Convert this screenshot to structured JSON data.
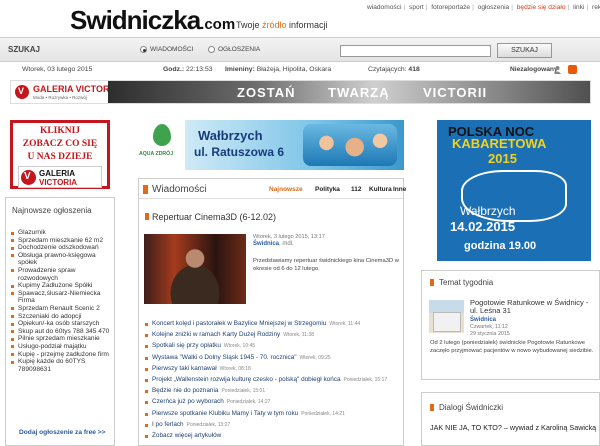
{
  "header": {
    "logo_main": "Swidniczka",
    "logo_domain": ".com",
    "tagline_before": "Twoje ",
    "tagline_highlight": "źródło",
    "tagline_after": " informacji",
    "nav": [
      {
        "label": "wiadomości"
      },
      {
        "label": "sport"
      },
      {
        "label": "fotoreportaże"
      },
      {
        "label": "ogłoszenia"
      },
      {
        "label": "będzie się działo"
      },
      {
        "label": "linki"
      },
      {
        "label": "reklama"
      }
    ]
  },
  "search": {
    "label": "SZUKAJ",
    "option_news": "WIADOMOŚCI",
    "option_ads": "OGŁOSZENIA",
    "value": "",
    "button": "SZUKAJ"
  },
  "infobar": {
    "date": "Wtorek, 03 lutego 2015",
    "time_label": "Godz.:",
    "time": "22:13:53",
    "names_label": "Imieniny:",
    "names": "Błażeja, Hipolita, Oskara",
    "readers_label": "Czytających:",
    "readers": "418",
    "login_status": "Niezalogowany"
  },
  "banner": {
    "logo_line1": "GALERIA VICTORIA",
    "logo_line2": "Moda • Rozrywka • Rozwój",
    "words": [
      "ZOSTAŃ",
      "TWARZĄ",
      "VICTORII"
    ]
  },
  "left_ad": {
    "line1": "KLIKNIJ",
    "line2": "ZOBACZ CO SIĘ",
    "line3": "U NAS DZIEJE",
    "brand1": "GALERIA",
    "brand2": "VICTORIA"
  },
  "classifieds": {
    "title": "Najnowsze ogłoszenia",
    "items": [
      "Glazurnik",
      "Sprzedam mieszkanie 62 m2",
      "Dochodzenie odszkodowań",
      "Obsługa prawno-księgowa spółek",
      "Prowadzenie spraw rozwodowych",
      "Kupimy Zadłużone Spółki",
      "Spawacz,ślusarz-Niemiecka Firma",
      "Sprzedam Renault Scenic 2",
      "Szczeniaki do adopcji",
      "Opiekun/-ka osób starszych",
      "Skup aut do 60tys 788 345 470",
      "Pilnie sprzedam mieszkanie",
      "Usługo-podział majątku",
      "Kupię - przejmę zadłużone firm",
      "Kupię każde do 60TYS 789098631"
    ],
    "add_link": "Dodaj ogłoszenie za free >>"
  },
  "center_ad": {
    "brand": "AQUA ZDRÓJ",
    "city": "Wałbrzych",
    "street": "ul. Ratuszowa 6"
  },
  "news": {
    "title": "Wiadomości",
    "tabs": [
      "Najnowsze",
      "Polityka",
      "112",
      "Kultura",
      "Inne"
    ],
    "featured": {
      "title": "Repertuar Cinema3D (6-12.02)",
      "meta": "Wtorek, 3 lutego 2015, 13:17",
      "category": "Świdnica",
      "category_suffix": ", mdl.",
      "description": "Przedstawiamy repertuar świdnickiego kina Cinema3D w okresie od 6 do 12 lutego."
    },
    "items": [
      {
        "title": "Koncert kolęd i pastorałek w Bazylice Mniejszej w Strzegomiu",
        "date": "Wtorek, 11:44"
      },
      {
        "title": "Kolejne zniżki w ramach Karty Dużej Rodziny",
        "date": "Wtorek, 11:38"
      },
      {
        "title": "Spotkali się przy opłatku",
        "date": "Wtorek, 10:45"
      },
      {
        "title": "Wystawa \"Walki o Dolny Śląsk 1945 - 70. rocznica\"",
        "date": "Wtorek, 09:25"
      },
      {
        "title": "Pierwszy taki karnawał",
        "date": "Wtorek, 08:18"
      },
      {
        "title": "Projekt „Wallenstein rozwija kulturę czesko - polską\" dobiegł końca",
        "date": "Poniedziałek, 15:17"
      },
      {
        "title": "Będzie nie do poznania",
        "date": "Poniedziałek, 15:01"
      },
      {
        "title": "Czerńca już po wyborach",
        "date": "Poniedziałek, 14:27"
      },
      {
        "title": "Pierwsze spotkanie Klubiku Mamy i Taty w tym roku",
        "date": "Poniedziałek, 14:21"
      },
      {
        "title": "I po ferlach",
        "date": "Poniedziałek, 13:27"
      },
      {
        "title": "Zobacz więcej artykułów",
        "date": ""
      }
    ]
  },
  "right_ad": {
    "line1": "POLSKA NOC",
    "line2": "KABARETOWA",
    "line3": "2015",
    "city": "Wałbrzych",
    "date": "14.02.2015",
    "time": "godzina 19.00"
  },
  "temat": {
    "title": "Temat tygodnia",
    "headline": "Pogotowie Ratunkowe w Świdnicy - ul. Leśna 31",
    "category": "Świdnica",
    "date": "Czwartek, 11:12",
    "comment": "29 stycznia 2015",
    "description": "Od 2 lutego (poniedziałek) świdnickie Pogotowie Ratunkowe zaczęło przyjmować pacjentów w nowo wybudowanej siedzibie."
  },
  "dialogi": {
    "title": "Dialogi Świdniczki",
    "headline": "JAK NIE JA, TO KTO? – wywiad z Karoliną Sawicką"
  },
  "colors": {
    "accent": "#e06a1a",
    "link": "#1e3f72",
    "brand_red": "#c4161c"
  }
}
